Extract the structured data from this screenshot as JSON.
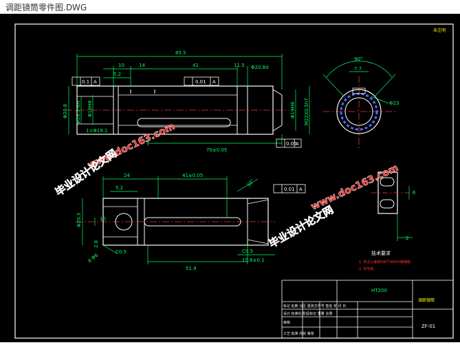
{
  "window": {
    "title": "调距镜筒零件图.DWG"
  },
  "colors": {
    "background": "#000000",
    "line": "#ffffff",
    "dim": "#00ff66",
    "center": "#ff3333",
    "hatch": "#4d6bff",
    "note": "#ff3333",
    "yellow": "#ffff00"
  },
  "drawing": {
    "corner_mark": "未注明",
    "top_view": {
      "dim_overall": "85.5",
      "dim_10": "10",
      "dim_14": "14",
      "dim_41": "41",
      "dim_11_5": "11.5",
      "dim_5_2": "5.2",
      "dim_phi20": "Φ20.8d",
      "dim_phi20_8": "Φ20.8",
      "dim_phi19_5": "Φ19.5-6H",
      "dim_phi16": "Φ16H8",
      "dim_phi19_h": "Φ19H8",
      "dim_m": "M22X0.5h7",
      "dim_1x": "1×Φ19.2",
      "dim_70": "70±0.05",
      "tol_a": "A",
      "tol_sym_left": "0.1",
      "tol_sym_mid": "0.01",
      "tol_bottom": "0.05",
      "tol_bottom_ref": "A"
    },
    "end_view": {
      "angle": "90°",
      "dim_7_7": "7.7",
      "dim_phi23": "Φ23"
    },
    "bottom_view": {
      "dim_24": "24",
      "dim_41_2": "41±0.05",
      "dim_5_2": "5.2",
      "dim_10": "10",
      "dim_phi20_3": "Φ20.3",
      "dim_2_8": "2.8",
      "dim_4_phi": "4-Φ6",
      "dim_c0_5_left": "C0.5",
      "dim_c0_5_right": "C0.5",
      "dim_51_9": "51.9",
      "dim_15_6": "15.6±0.1",
      "dim_30": "30°",
      "tol_ref": "0.01",
      "tol_a": "A"
    },
    "right_detail": {
      "dim_6": "6",
      "dim_2": "2"
    },
    "tech_notes": {
      "title": "技术要求",
      "line1": "1. 未注公差按GB/T1804-f级精度。",
      "line2": "2. 去毛刺。"
    },
    "title_block": {
      "material": "HT200",
      "part_name": "调距镜筒",
      "drawing_no": "ZF-01",
      "r1": "标记 处数 分区 更改文件号 签名 年 月 日",
      "r2": "设计  标准化    阶段标记 重量 比例",
      "r3": "审核",
      "r4": "工艺   批准    共张 第张"
    },
    "watermarks": {
      "url1": "www.doc163.com",
      "cn1": "毕业设计论文网",
      "url2": "www.doc163.com",
      "cn2": "毕业设计论文网"
    }
  }
}
